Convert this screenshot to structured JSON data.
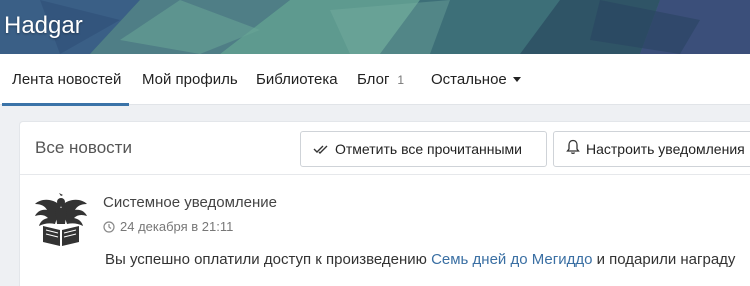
{
  "site": {
    "title": "Hadgar"
  },
  "nav": {
    "items": [
      {
        "label": "Лента новостей",
        "active": true
      },
      {
        "label": "Мой профиль"
      },
      {
        "label": "Библиотека"
      },
      {
        "label": "Блог",
        "badge": "1"
      },
      {
        "label": "Остальное",
        "icon": "caret-down-icon"
      }
    ]
  },
  "news": {
    "title": "Все новости",
    "mark_all_read": {
      "label": "Отметить все прочитанными",
      "icon": "double-check-icon"
    },
    "notify_settings": {
      "label": "Настроить уведомления",
      "icon": "bell-icon"
    },
    "items": [
      {
        "title": "Системное уведомление",
        "time": "24 декабря в 21:11",
        "time_icon": "clock-icon",
        "avatar_icon": "phoenix-book-logo-icon",
        "text_before": "Вы успешно оплатили доступ к произведению ",
        "link": "Семь дней до Мегиддо",
        "text_after": " и подарили награду"
      }
    ]
  },
  "colors": {
    "accent": "#3b73a8",
    "link": "#3a6fa3",
    "banner": "#3d6f7a"
  }
}
